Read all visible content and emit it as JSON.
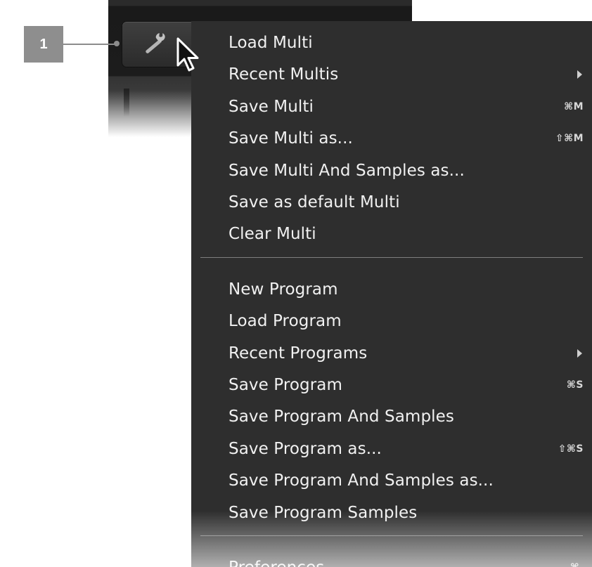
{
  "callout": {
    "number": "1"
  },
  "toolbar": {
    "button_icon": "wrench-icon"
  },
  "menu": {
    "groups": [
      [
        {
          "label": "Load Multi",
          "shortcut": "",
          "submenu": false
        },
        {
          "label": "Recent Multis",
          "shortcut": "",
          "submenu": true
        },
        {
          "label": "Save Multi",
          "shortcut": "⌘M",
          "submenu": false
        },
        {
          "label": "Save Multi as...",
          "shortcut": "⇧⌘M",
          "submenu": false
        },
        {
          "label": "Save Multi And Samples as...",
          "shortcut": "",
          "submenu": false
        },
        {
          "label": "Save as default Multi",
          "shortcut": "",
          "submenu": false
        },
        {
          "label": "Clear Multi",
          "shortcut": "",
          "submenu": false
        }
      ],
      [
        {
          "label": "New Program",
          "shortcut": "",
          "submenu": false
        },
        {
          "label": "Load Program",
          "shortcut": "",
          "submenu": false
        },
        {
          "label": "Recent Programs",
          "shortcut": "",
          "submenu": true
        },
        {
          "label": "Save Program",
          "shortcut": "⌘S",
          "submenu": false
        },
        {
          "label": "Save Program And Samples",
          "shortcut": "",
          "submenu": false
        },
        {
          "label": "Save Program as...",
          "shortcut": "⇧⌘S",
          "submenu": false
        },
        {
          "label": "Save Program And Samples as...",
          "shortcut": "",
          "submenu": false
        },
        {
          "label": "Save Program Samples",
          "shortcut": "",
          "submenu": false
        }
      ],
      [
        {
          "label": "Preferences",
          "shortcut": "⌘,",
          "submenu": false
        }
      ]
    ]
  },
  "colors": {
    "menu_background": "#2e2e2e",
    "menu_text": "#f1f1f1",
    "separator": "#7e7e7e",
    "callout": "#8e8e8e"
  }
}
